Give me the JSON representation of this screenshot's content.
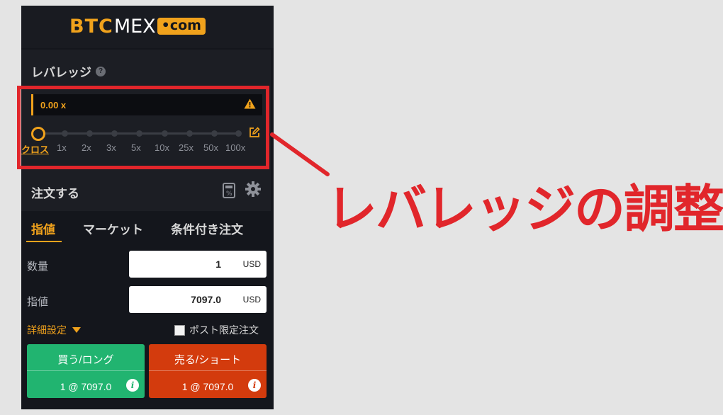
{
  "brand": {
    "logo_btc": "BTC",
    "logo_mex": "MEX",
    "logo_com": "•com"
  },
  "leverage": {
    "title": "レバレッジ",
    "value": "0.00 x",
    "ticks": [
      "クロス",
      "1x",
      "2x",
      "3x",
      "5x",
      "10x",
      "25x",
      "50x",
      "100x"
    ],
    "selected_tick": "クロス"
  },
  "order": {
    "title": "注文する",
    "tabs": [
      "指値",
      "マーケット",
      "条件付き注文"
    ],
    "active_tab": "指値",
    "quantity": {
      "label": "数量",
      "value": "1",
      "unit": "USD"
    },
    "price": {
      "label": "指値",
      "value": "7097.0",
      "unit": "USD"
    },
    "advanced_label": "詳細設定",
    "post_only_label": "ポスト限定注文",
    "post_only_checked": false,
    "buy": {
      "label": "買う/ロング",
      "sub": "1 @ 7097.0"
    },
    "sell": {
      "label": "売る/ショート",
      "sub": "1 @ 7097.0"
    }
  },
  "annotation": {
    "text": "レバレッジの調整"
  },
  "colors": {
    "accent": "#f0a21c",
    "buy": "#21b470",
    "sell": "#d33b0d",
    "highlight": "#e1262b"
  }
}
